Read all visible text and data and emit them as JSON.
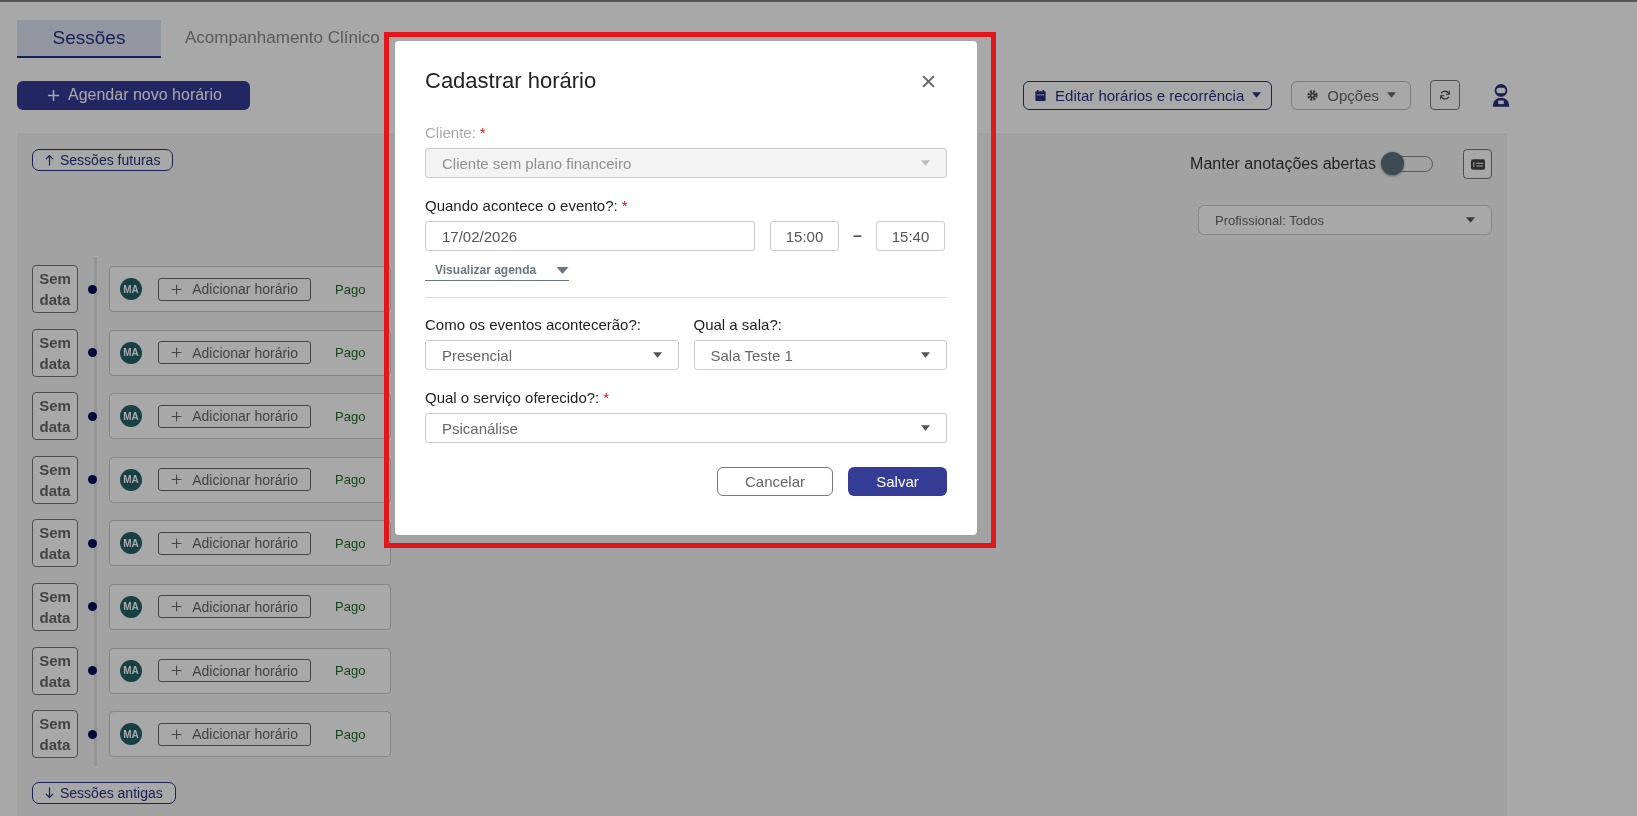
{
  "tabs": [
    {
      "label": "Sessões",
      "selected": true
    },
    {
      "label": "Acompanhamento Clínico",
      "selected": false
    }
  ],
  "toolbar": {
    "schedule_button": "Agendar novo horário",
    "edit_button": "Editar horários e recorrência",
    "options_button": "Opções"
  },
  "sessions": {
    "future_button": "Sessões futuras",
    "past_button": "Sessões antigas",
    "keep_notes": {
      "label": "Manter anotações abertas",
      "on": false
    },
    "professional_filter": "Profissional: Todos",
    "rows": [
      {
        "date": "Sem data",
        "avatar": "MA",
        "add_button": "Adicionar horário",
        "status": "Pago"
      },
      {
        "date": "Sem data",
        "avatar": "MA",
        "add_button": "Adicionar horário",
        "status": "Pago"
      },
      {
        "date": "Sem data",
        "avatar": "MA",
        "add_button": "Adicionar horário",
        "status": "Pago"
      },
      {
        "date": "Sem data",
        "avatar": "MA",
        "add_button": "Adicionar horário",
        "status": "Pago"
      },
      {
        "date": "Sem data",
        "avatar": "MA",
        "add_button": "Adicionar horário",
        "status": "Pago"
      },
      {
        "date": "Sem data",
        "avatar": "MA",
        "add_button": "Adicionar horário",
        "status": "Pago"
      },
      {
        "date": "Sem data",
        "avatar": "MA",
        "add_button": "Adicionar horário",
        "status": "Pago"
      },
      {
        "date": "Sem data",
        "avatar": "MA",
        "add_button": "Adicionar horário",
        "status": "Pago"
      }
    ]
  },
  "modal": {
    "title": "Cadastrar horário",
    "client": {
      "label": "Cliente:",
      "required_mark": "*",
      "value": "Cliente sem plano financeiro",
      "disabled": true
    },
    "when": {
      "label": "Quando acontece o evento?:",
      "required_mark": "*",
      "date": "17/02/2026",
      "start": "15:00",
      "separator": "–",
      "end": "15:40"
    },
    "view_schedule": "Visualizar agenda",
    "mode": {
      "label": "Como os eventos acontecerão?:",
      "value": "Presencial",
      "disabled": false
    },
    "room": {
      "label": "Qual a sala?:",
      "value": "Sala Teste 1",
      "disabled": false
    },
    "service": {
      "label": "Qual o serviço oferecido?:",
      "required_mark": "*",
      "value": "Psicanálise",
      "disabled": false
    },
    "cancel_button": "Cancelar",
    "save_button": "Salvar"
  }
}
